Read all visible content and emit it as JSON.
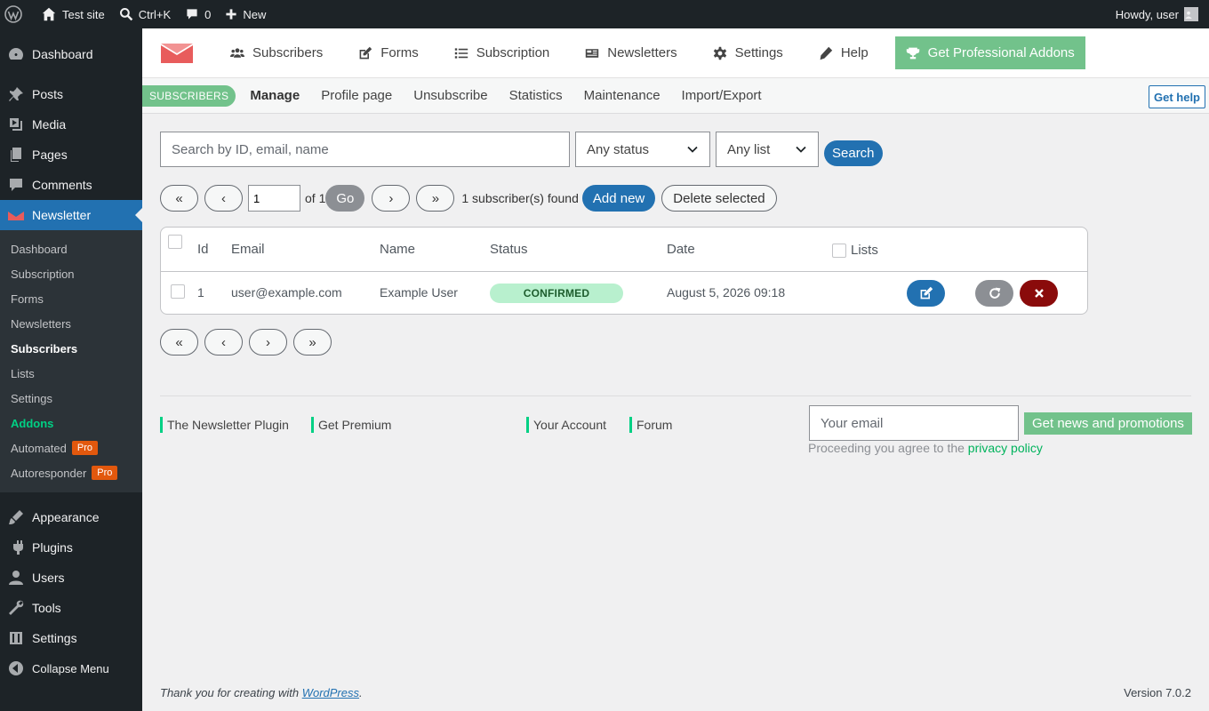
{
  "admin_bar": {
    "site_name": "Test site",
    "search_shortcut": "Ctrl+K",
    "comments_count": "0",
    "new_label": "New",
    "howdy": "Howdy, user"
  },
  "side_menu": {
    "dashboard": "Dashboard",
    "posts": "Posts",
    "media": "Media",
    "pages": "Pages",
    "comments": "Comments",
    "newsletter": "Newsletter",
    "submenu": {
      "dashboard": "Dashboard",
      "subscription": "Subscription",
      "forms": "Forms",
      "newsletters": "Newsletters",
      "subscribers": "Subscribers",
      "lists": "Lists",
      "settings": "Settings",
      "addons": "Addons",
      "automated": "Automated",
      "autoresponder": "Autoresponder",
      "pro_badge": "Pro"
    },
    "appearance": "Appearance",
    "plugins": "Plugins",
    "users": "Users",
    "tools": "Tools",
    "settings": "Settings",
    "collapse": "Collapse Menu"
  },
  "plugin_nav": {
    "subscribers": "Subscribers",
    "forms": "Forms",
    "subscription": "Subscription",
    "newsletters": "Newsletters",
    "settings": "Settings",
    "help": "Help",
    "pro_addons": "Get Professional Addons"
  },
  "subnav": {
    "badge": "SUBSCRIBERS",
    "manage": "Manage",
    "profile_page": "Profile page",
    "unsubscribe": "Unsubscribe",
    "statistics": "Statistics",
    "maintenance": "Maintenance",
    "import_export": "Import/Export",
    "get_help": "Get help"
  },
  "search": {
    "placeholder": "Search by ID, email, name",
    "status_value": "Any status",
    "list_value": "Any list",
    "button": "Search"
  },
  "pager": {
    "first": "«",
    "prev": "‹",
    "next": "›",
    "last": "»",
    "page_value": "1",
    "of_text": "of 1",
    "go": "Go",
    "found": "1 subscriber(s) found",
    "add_new": "Add new",
    "delete_selected": "Delete selected"
  },
  "table": {
    "headers": {
      "id": "Id",
      "email": "Email",
      "name": "Name",
      "status": "Status",
      "date": "Date",
      "lists": "Lists"
    },
    "rows": [
      {
        "id": "1",
        "email": "user@example.com",
        "name": "Example User",
        "status": "CONFIRMED",
        "date": "August 5, 2026 09:18"
      }
    ]
  },
  "footer_links": {
    "plugin": "The Newsletter Plugin",
    "premium": "Get Premium",
    "account": "Your Account",
    "forum": "Forum"
  },
  "newsletter_signup": {
    "placeholder": "Your email",
    "button": "Get news and promotions",
    "note": "Proceeding you agree to the",
    "privacy": "privacy policy"
  },
  "wp_footer": {
    "thanks": "Thank you for creating with",
    "wordpress": "WordPress",
    "period": ".",
    "version": "Version 7.0.2"
  },
  "colors": {
    "accent_blue": "#2271b1",
    "tnp_green": "#72c28b",
    "addons_green": "#00d084",
    "delete_red": "#8a0b0b",
    "pro_orange": "#e2580d"
  }
}
